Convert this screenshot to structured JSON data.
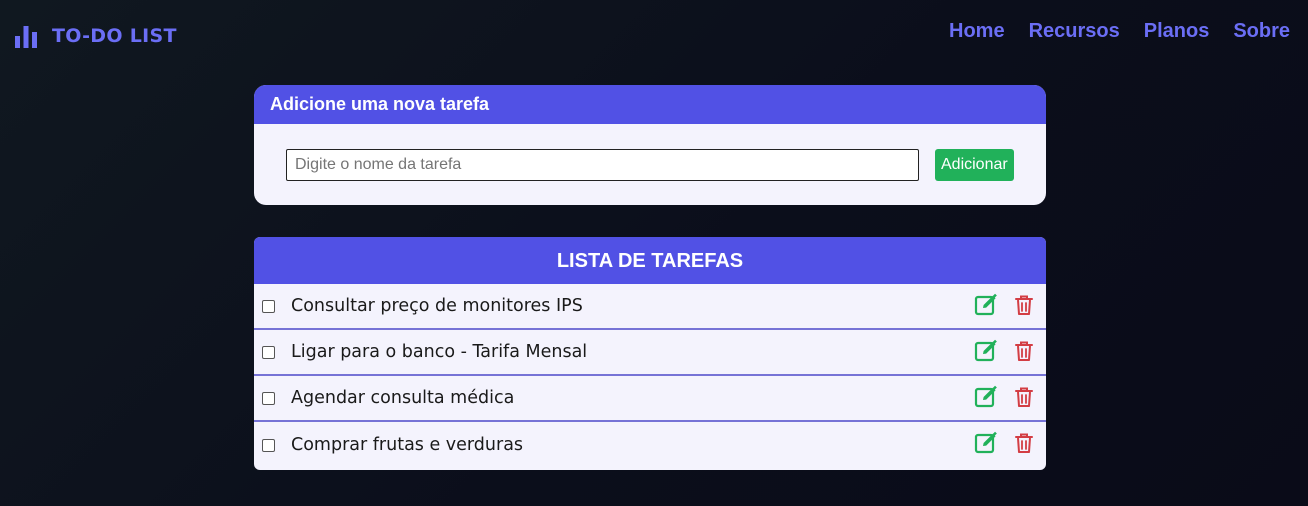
{
  "app": {
    "logo_text": "TO-DO LIST",
    "accent_color": "#6b6ef5"
  },
  "nav": {
    "items": [
      {
        "label": "Home"
      },
      {
        "label": "Recursos"
      },
      {
        "label": "Planos"
      },
      {
        "label": "Sobre"
      }
    ]
  },
  "add_card": {
    "title": "Adicione uma nova tarefa",
    "input_placeholder": "Digite o nome da tarefa",
    "input_value": "",
    "button_label": "Adicionar",
    "button_color": "#21b15a"
  },
  "list_card": {
    "title": "LISTA DE TAREFAS",
    "header_color": "#5151e5",
    "tasks": [
      {
        "text": "Consultar preço de monitores IPS",
        "checked": false,
        "edit_icon": "edit-icon",
        "delete_icon": "trash-icon"
      },
      {
        "text": "Ligar para o banco - Tarifa Mensal",
        "checked": false,
        "edit_icon": "edit-icon",
        "delete_icon": "trash-icon"
      },
      {
        "text": "Agendar consulta médica",
        "checked": false,
        "edit_icon": "edit-icon",
        "delete_icon": "trash-icon"
      },
      {
        "text": "Comprar frutas e verduras",
        "checked": false,
        "edit_icon": "edit-icon",
        "delete_icon": "trash-icon"
      }
    ],
    "edit_color": "#21b15a",
    "delete_color": "#d33d44"
  }
}
